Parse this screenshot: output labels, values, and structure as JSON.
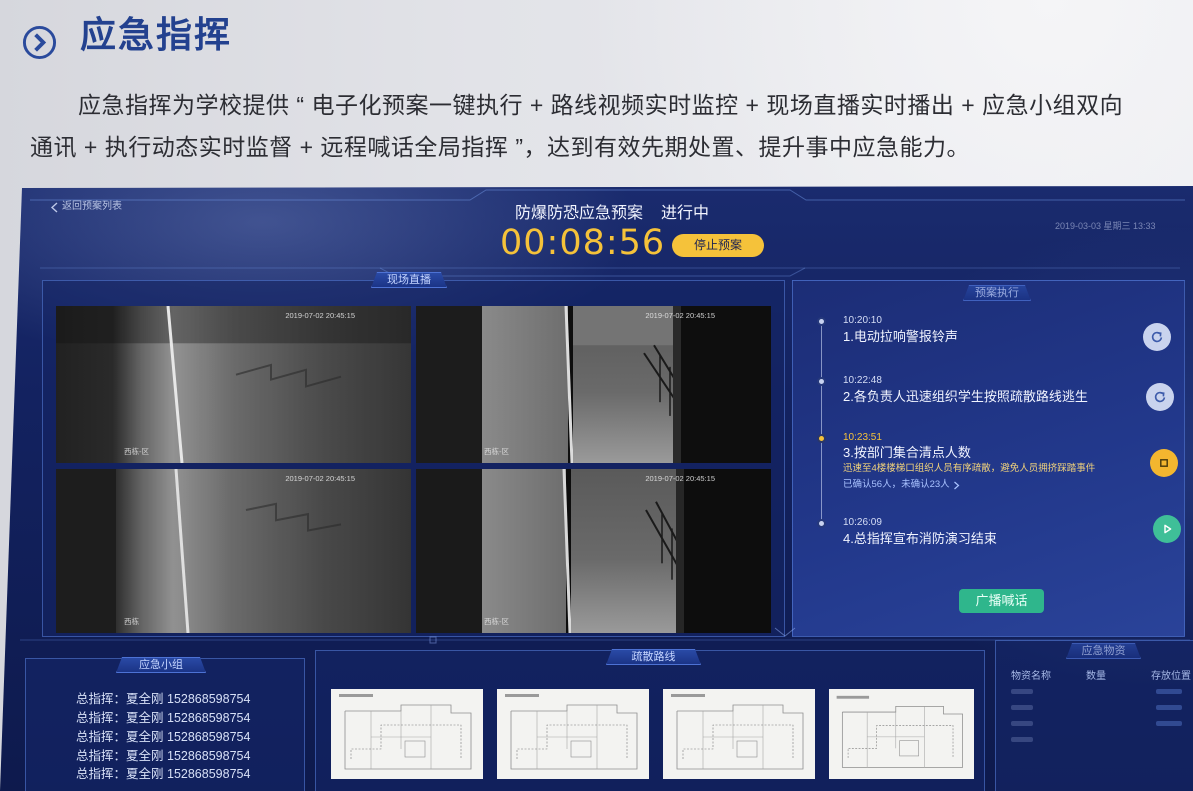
{
  "page": {
    "title": "应急指挥",
    "intro_line1": "应急指挥为学校提供 “ 电子化预案一键执行 + 路线视频实时监控 + 现场直播实时播出 + 应急小组双向",
    "intro_line2": "通讯 + 执行动态实时监督 + 远程喊话全局指挥 ”，达到有效先期处置、提升事中应急能力。",
    "title_icon": "circle-chevron-right-icon"
  },
  "dashboard": {
    "back_label": "返回预案列表",
    "plan_name": "防爆防恐应急预案",
    "plan_status": "进行中",
    "elapsed": "00:08:56",
    "stop_button": "停止预案",
    "datetime": "2019-03-03 星期三  13:33",
    "live": {
      "label": "现场直播",
      "feeds": [
        {
          "timestamp": "2019-07-02 20:45:15",
          "camera": "西栋-区"
        },
        {
          "timestamp": "2019-07-02 20:45:15",
          "camera": "西栋-区"
        },
        {
          "timestamp": "2019-07-02 20:45:15",
          "camera": "西栋"
        },
        {
          "timestamp": "2019-07-02 20:45:15",
          "camera": "西栋-区"
        }
      ]
    },
    "process": {
      "label": "预案执行",
      "steps": [
        {
          "time": "10:20:10",
          "title": "1.电动拉响警报铃声",
          "icon": "refresh-icon",
          "dot_color": "#c8d2f0",
          "icon_bg": "#c9d3ee"
        },
        {
          "time": "10:22:48",
          "title": "2.各负责人迅速组织学生按照疏散路线逃生",
          "icon": "refresh-icon",
          "dot_color": "#c8d2f0",
          "icon_bg": "#c9d3ee"
        },
        {
          "time": "10:23:51",
          "title": "3.按部门集合清点人数",
          "detail": "迅速至4楼楼梯口组织人员有序疏散，避免人员拥挤踩踏事件",
          "confirm": "已确认56人，未确认23人",
          "icon": "stop-icon",
          "dot_color": "#f5c23a",
          "icon_bg": "#f3b62f"
        },
        {
          "time": "10:26:09",
          "title": "4.总指挥宣布消防演习结束",
          "icon": "play-icon",
          "dot_color": "#c8d2f0",
          "icon_bg": "#3fbf98"
        }
      ],
      "broadcast_button": "广播喊话"
    },
    "team": {
      "label": "应急小组",
      "members": [
        {
          "role": "总指挥：",
          "name": "夏全刚",
          "phone": " 152868598754"
        },
        {
          "role": "总指挥：",
          "name": "夏全刚",
          "phone": " 152868598754"
        },
        {
          "role": "总指挥：",
          "name": "夏全刚",
          "phone": " 152868598754"
        },
        {
          "role": "总指挥：",
          "name": "夏全刚",
          "phone": " 152868598754"
        },
        {
          "role": "总指挥：",
          "name": "夏全刚",
          "phone": " 152868598754"
        }
      ]
    },
    "routes": {
      "label": "疏散路线"
    },
    "supplies": {
      "label": "应急物资",
      "columns": [
        "物资名称",
        "数量",
        "存放位置"
      ]
    }
  },
  "colors": {
    "title_blue": "#23418f",
    "accent_yellow": "#f5c23a",
    "action_green": "#2fb68c",
    "ui_navy": "#132260"
  }
}
